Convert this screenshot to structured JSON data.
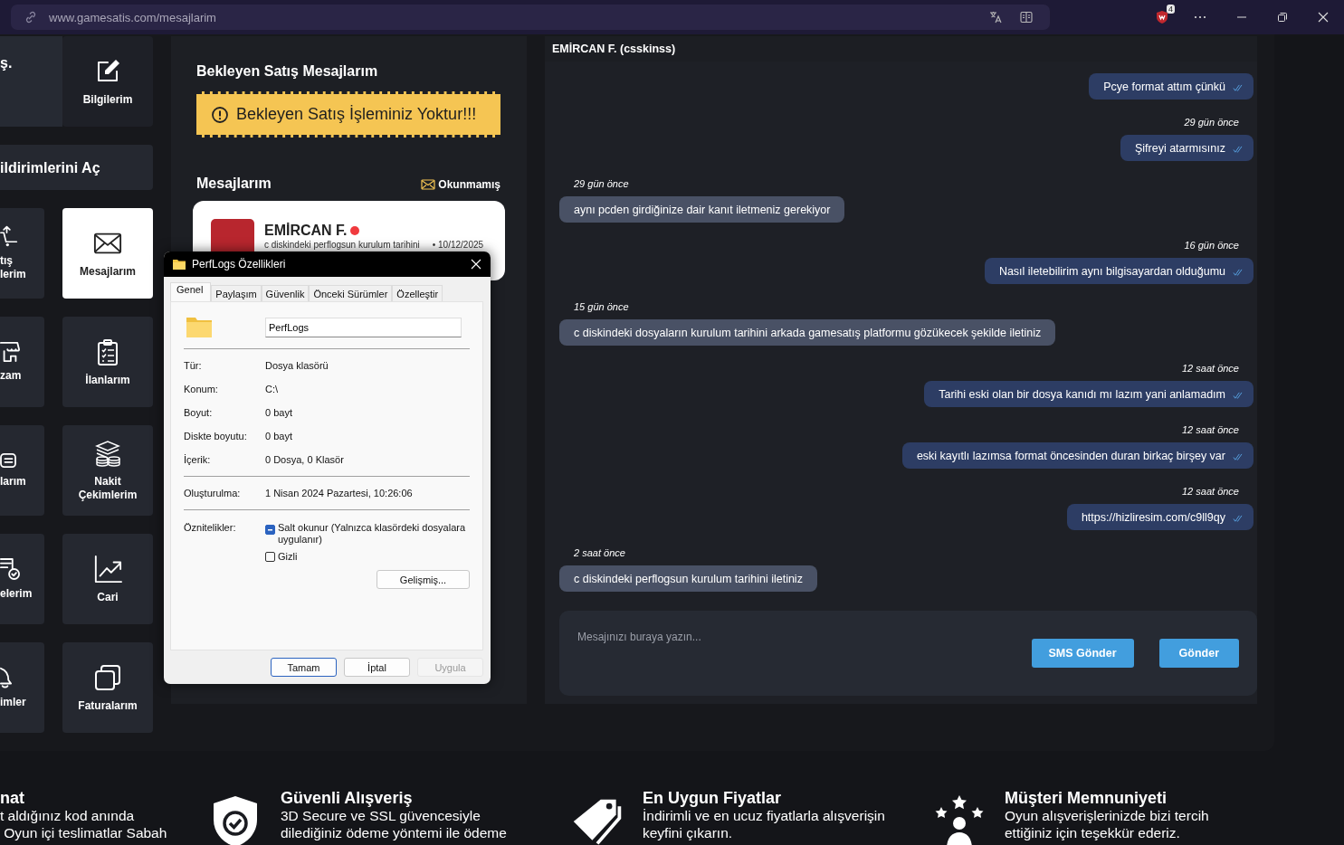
{
  "browser": {
    "url": "www.gamesatis.com/mesajlarim",
    "extension_badge": "4"
  },
  "sidebar": {
    "tiles": [
      {
        "kind": "profile",
        "label": "ş.",
        "selected": false
      },
      {
        "kind": "tile",
        "label": "Bilgilerim",
        "selected": false
      },
      {
        "kind": "banner",
        "label": "ildirimlerini Aç",
        "selected": false
      },
      {
        "kind": "edge",
        "label": "tış\nlerim",
        "selected": false
      },
      {
        "kind": "tile",
        "label": "Mesajlarım",
        "selected": true
      },
      {
        "kind": "edge",
        "label": "zam",
        "selected": false
      },
      {
        "kind": "tile",
        "label": "İlanlarım",
        "selected": false
      },
      {
        "kind": "edge",
        "label": "larım",
        "selected": false
      },
      {
        "kind": "tile",
        "label": "Nakit\nÇekimlerim",
        "selected": false
      },
      {
        "kind": "edge",
        "label": "elerim",
        "selected": false
      },
      {
        "kind": "tile",
        "label": "Cari",
        "selected": false
      },
      {
        "kind": "edge",
        "label": "imler",
        "selected": false
      },
      {
        "kind": "tile",
        "label": "Faturalarım",
        "selected": false
      }
    ]
  },
  "pending": {
    "title": "Bekleyen Satış Mesajlarım",
    "notice": "Bekleyen Satış İşleminiz Yoktur!!!"
  },
  "inbox": {
    "title": "Mesajlarım",
    "filter": "Okunmamış",
    "conversations": [
      {
        "name": "EMİRCAN F.",
        "unread": true,
        "preview": "c diskindeki perflogsun kurulum tarihini",
        "date": "• 10/12/2025"
      }
    ]
  },
  "dialog": {
    "title": "PerfLogs Özellikleri",
    "tabs": [
      {
        "label": "Genel",
        "selected": true
      },
      {
        "label": "Paylaşım",
        "selected": false
      },
      {
        "label": "Güvenlik",
        "selected": false
      },
      {
        "label": "Önceki Sürümler",
        "selected": false
      },
      {
        "label": "Özelleştir",
        "selected": false
      }
    ],
    "name": "PerfLogs",
    "groups": [
      [
        {
          "label": "Tür:",
          "value": "Dosya klasörü"
        },
        {
          "label": "Konum:",
          "value": "C:\\"
        },
        {
          "label": "Boyut:",
          "value": "0 bayt"
        },
        {
          "label": "Diskte boyutu:",
          "value": "0 bayt"
        },
        {
          "label": "İçerik:",
          "value": "0 Dosya, 0 Klasör"
        }
      ],
      [
        {
          "label": "Oluşturulma:",
          "value": "1 Nisan 2024 Pazartesi, 10:26:06"
        }
      ]
    ],
    "attributes": {
      "label": "Öznitelikler:",
      "options": [
        {
          "label": "Salt okunur (Yalnızca klasördeki dosyalara uygulanır)",
          "indeterminate": true
        },
        {
          "label": "Gizli",
          "indeterminate": false
        }
      ]
    },
    "advanced": "Gelişmiş...",
    "buttons": [
      {
        "label": "Tamam",
        "kind": "default"
      },
      {
        "label": "İptal",
        "kind": "normal"
      },
      {
        "label": "Uygula",
        "kind": "disabled"
      }
    ]
  },
  "chat": {
    "header": "EMİRCAN F. (csskinss)",
    "messages": [
      {
        "kind": "sent",
        "text": "Pcye format attım çünkü"
      },
      {
        "kind": "sent",
        "time": "29 gün önce",
        "text": "Şifreyi atarmısınız"
      },
      {
        "kind": "received",
        "time": "29 gün önce",
        "text": "aynı pcden girdiğinize dair kanıt iletmeniz gerekiyor"
      },
      {
        "kind": "sent",
        "time": "16 gün önce",
        "text": "Nasıl iletebilirim aynı bilgisayardan olduğumu"
      },
      {
        "kind": "received",
        "time": "15 gün önce",
        "text": "c diskindeki dosyaların kurulum tarihini arkada gamesatış platformu gözükecek şekilde iletiniz"
      },
      {
        "kind": "sent",
        "time": "12 saat önce",
        "text": "Tarihi eski olan bir dosya kanıdı mı lazım yani anlamadım"
      },
      {
        "kind": "sent",
        "time": "12 saat önce",
        "text": "eski kayıtlı lazımsa format öncesinden duran birkaç birşey var"
      },
      {
        "kind": "sent",
        "time": "12 saat önce",
        "text": "https://hizliresim.com/c9ll9qy"
      },
      {
        "kind": "received",
        "time": "2 saat önce",
        "text": "c diskindeki perflogsun kurulum tarihini iletiniz"
      }
    ],
    "input": {
      "placeholder": "Mesajınızı buraya yazın..."
    },
    "buttons": [
      "SMS Gönder",
      "Gönder"
    ]
  },
  "features": [
    {
      "kind": "edge",
      "title": "nat",
      "text": "t aldığınız kod anında\n Oyun içi teslimatlar Sabah"
    },
    {
      "kind": "shield",
      "title": "Güvenli Alışveriş",
      "text": "3D Secure ve SSL güvencesiyle\ndilediğiniz ödeme yöntemi ile ödeme"
    },
    {
      "kind": "tag",
      "title": "En Uygun Fiyatlar",
      "text": "İndirimli ve en ucuz fiyatlarla alışverişin\nkeyfini çıkarın."
    },
    {
      "kind": "people",
      "title": "Müşteri Memnuniyeti",
      "text": "Oyun alışverişlerinizde bizi tercih\nettiğiniz için teşekkür ederiz."
    }
  ]
}
